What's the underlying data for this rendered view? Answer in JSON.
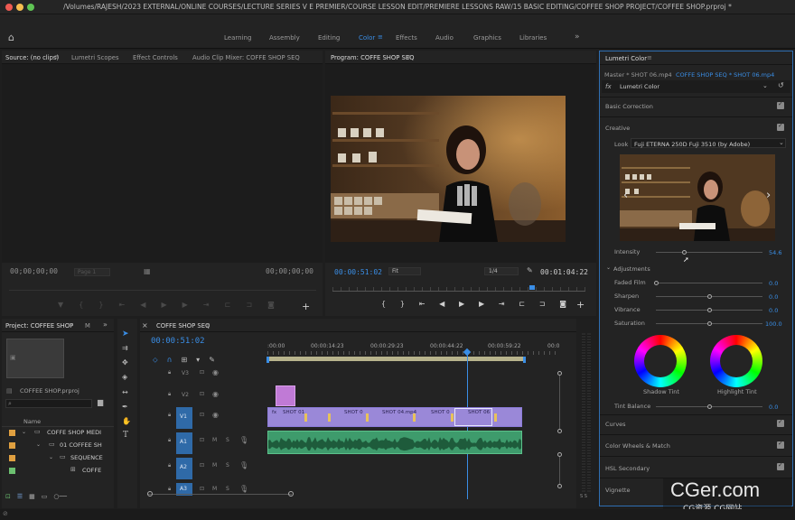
{
  "window": {
    "title": "/Volumes/RAJESH/2023 EXTERNAL/ONLINE COURSES/LECTURE SERIES V E PREMIER/COURSE LESSON EDIT/PREMIERE LESSONS RAW/15 BASIC EDITING/COFFEE SHOP PROJECT/COFFEE SHOP.prproj *"
  },
  "workspaces": {
    "items": [
      "Learning",
      "Assembly",
      "Editing",
      "Color",
      "Effects",
      "Audio",
      "Graphics",
      "Libraries"
    ],
    "active": "Color",
    "more": "»"
  },
  "source_panel": {
    "tabs": [
      "Source: (no clips)",
      "Lumetri Scopes",
      "Effect Controls",
      "Audio Clip Mixer: COFFE SHOP SEQ"
    ],
    "tc_left": "00;00;00;00",
    "tc_right": "00;00;00;00",
    "page": "Page 1"
  },
  "program_panel": {
    "title": "Program: COFFE SHOP SEQ",
    "tc_current": "00:00:51:02",
    "fit": "Fit",
    "ratio": "1/4",
    "tc_duration": "00:01:04:22"
  },
  "lumetri": {
    "title": "Lumetri Color",
    "master": "Master * SHOT 06.mp4",
    "seq": "COFFE SHOP SEQ * SHOT 06.mp4",
    "fx": "fx",
    "effect": "Lumetri Color",
    "basic_correction": "Basic Correction",
    "creative": "Creative",
    "look_label": "Look",
    "look_value": "Fuji ETERNA 250D Fuji 3510 (by Adobe)",
    "intensity_label": "Intensity",
    "intensity_value": "54.6",
    "adjustments": "Adjustments",
    "sliders": [
      {
        "label": "Faded Film",
        "value": "0.0",
        "pos": 0.0
      },
      {
        "label": "Sharpen",
        "value": "0.0",
        "pos": 0.5
      },
      {
        "label": "Vibrance",
        "value": "0.0",
        "pos": 0.5
      },
      {
        "label": "Saturation",
        "value": "100.0",
        "pos": 0.5
      }
    ],
    "shadow_tint": "Shadow Tint",
    "highlight_tint": "Highlight Tint",
    "tint_balance_label": "Tint Balance",
    "tint_balance_value": "0.0",
    "sections": [
      "Curves",
      "Color Wheels & Match",
      "HSL Secondary",
      "Vignette"
    ]
  },
  "project": {
    "tabs": [
      "Project: COFFEE SHOP",
      "M"
    ],
    "file": "COFFEE SHOP.prproj",
    "name_header": "Name",
    "items": [
      "COFFE SHOP MEDI",
      "01 COFFEE SH",
      "SEQUENCE",
      "COFFE"
    ]
  },
  "timeline": {
    "title": "COFFE SHOP SEQ",
    "tc": "00:00:51:02",
    "ruler": [
      ":00:00",
      "00:00:14:23",
      "00:00:29:23",
      "00:00:44:22",
      "00:00:59:22",
      "00:0"
    ],
    "video_tracks": [
      "V3",
      "V2",
      "V1"
    ],
    "audio_tracks": [
      "A1",
      "A2",
      "A3"
    ],
    "clips": [
      "SHOT 01",
      "SHOT 0",
      "SHOT 04.mp4",
      "SHOT 0",
      "SHOT 06"
    ],
    "meter_labels": "S S"
  },
  "watermark": {
    "main": "CGer.com",
    "sub": "CG资源 CG网站"
  }
}
